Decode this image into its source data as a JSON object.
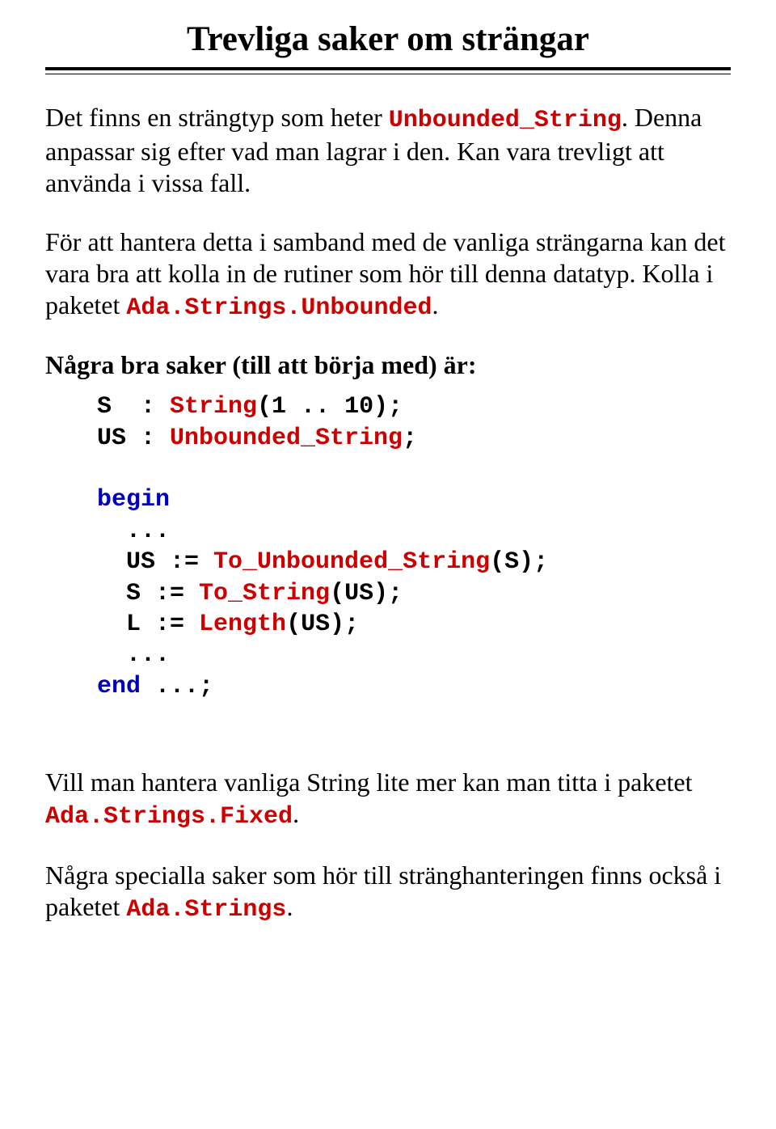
{
  "title": "Trevliga saker om strängar",
  "para1": {
    "pre": "Det finns en strängtyp som heter ",
    "code": "Unbounded_String",
    "post": ". Denna anpassar sig efter vad man lagrar i den. Kan vara trevligt att använda i vissa fall."
  },
  "para2": {
    "pre": "För att hantera detta i samband med de vanliga strängarna kan det vara bra att kolla in de rutiner som hör till denna datatyp. Kolla i paketet ",
    "code": "Ada.Strings.Unbounded",
    "post": "."
  },
  "heading1": "Några bra saker (till att börja med) är:",
  "code": {
    "decl_s_lhs": "S  : ",
    "decl_s_type": "String",
    "decl_s_rhs": "(1 .. 10);",
    "decl_us_lhs": "US : ",
    "decl_us_type": "Unbounded_String",
    "decl_us_semi": ";",
    "begin": "begin",
    "dots1": "  ...",
    "l1_lhs": "  US := ",
    "l1_fn": "To_Unbounded_String",
    "l1_rhs": "(S);",
    "l2_lhs": "  S := ",
    "l2_fn": "To_String",
    "l2_rhs": "(US);",
    "l3_lhs": "  L := ",
    "l3_fn": "Length",
    "l3_rhs": "(US);",
    "dots2": "  ...",
    "end": "end",
    "end_rhs": " ...;"
  },
  "para3": {
    "pre": "Vill man hantera vanliga String lite mer kan man titta i paketet ",
    "code": "Ada.Strings.Fixed",
    "post": "."
  },
  "para4": {
    "pre": "Några specialla saker som hör till stränghanteringen finns också i paketet ",
    "code": "Ada.Strings",
    "post": "."
  }
}
